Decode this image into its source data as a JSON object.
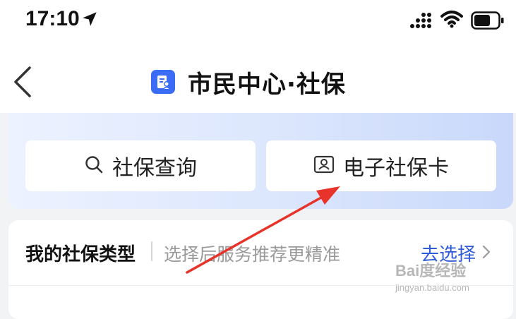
{
  "status_bar": {
    "time": "17:10",
    "icons": [
      "location-arrow-icon",
      "cellular-signal-icon",
      "wifi-icon",
      "battery-icon"
    ]
  },
  "nav": {
    "title": "市民中心·社保",
    "back_icon": "chevron-left-icon",
    "logo_icon": "document-user-icon"
  },
  "actions": [
    {
      "label": "社保查询",
      "icon": "search-icon"
    },
    {
      "label": "电子社保卡",
      "icon": "id-card-icon"
    }
  ],
  "insurance_type": {
    "title": "我的社保类型",
    "hint": "选择后服务推荐更精准",
    "select_label": "去选择",
    "select_icon": "chevron-right-icon"
  },
  "watermark": {
    "brand": "Bai度经验",
    "url": "jingyan.baidu.com"
  },
  "colors": {
    "accent": "#3b6cf5",
    "link": "#2f5bd9",
    "annotation_arrow": "#e8332b",
    "banner_gradient_start": "#edf2ff",
    "banner_gradient_end": "#c9d8fb"
  }
}
